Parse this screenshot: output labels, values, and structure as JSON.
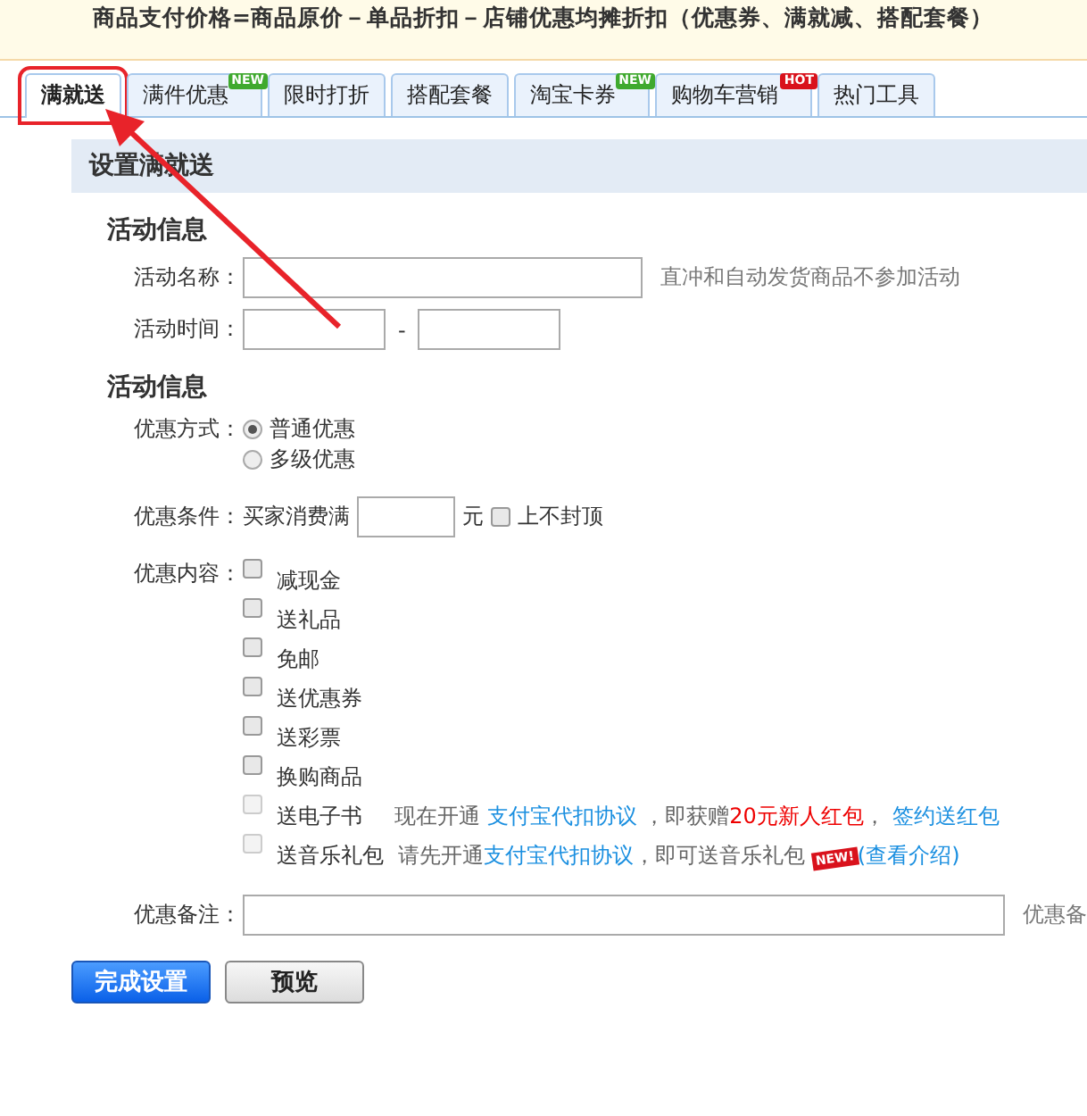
{
  "banner": {
    "text": "商品支付价格=商品原价－单品折扣－店铺优惠均摊折扣（优惠券、满就减、搭配套餐）"
  },
  "tabs": [
    {
      "label": "满就送",
      "selected": true
    },
    {
      "label": "满件优惠",
      "selected": false,
      "badge": {
        "kind": "new",
        "text": "NEW"
      }
    },
    {
      "label": "限时打折",
      "selected": false
    },
    {
      "label": "搭配套餐",
      "selected": false
    },
    {
      "label": "淘宝卡券",
      "selected": false,
      "badge": {
        "kind": "new",
        "text": "NEW"
      }
    },
    {
      "label": "购物车营销",
      "selected": false,
      "badge": {
        "kind": "hot",
        "text": "HOT"
      }
    },
    {
      "label": "热门工具",
      "selected": false
    }
  ],
  "panel": {
    "title": "设置满就送",
    "info": {
      "heading": "活动信息",
      "name_label": "活动名称：",
      "name_hint": "直冲和自动发货商品不参加活动",
      "time_label": "活动时间：",
      "time_separator": "-"
    },
    "offer": {
      "heading": "活动信息",
      "mode_label": "优惠方式：",
      "modes": [
        {
          "label": "普通优惠",
          "selected": true
        },
        {
          "label": "多级优惠",
          "selected": false
        }
      ],
      "condition_label": "优惠条件：",
      "condition_prefix": "买家消费满",
      "condition_unit": "元",
      "no_cap": {
        "label": "上不封顶",
        "checked": false
      },
      "content_label": "优惠内容：",
      "contents": [
        {
          "label": "减现金",
          "checked": false,
          "disabled": false
        },
        {
          "label": "送礼品",
          "checked": false,
          "disabled": false
        },
        {
          "label": "免邮",
          "checked": false,
          "disabled": false
        },
        {
          "label": "送优惠券",
          "checked": false,
          "disabled": false
        },
        {
          "label": "送彩票",
          "checked": false,
          "disabled": false
        },
        {
          "label": "换购商品",
          "checked": false,
          "disabled": false
        },
        {
          "label": "送电子书",
          "checked": false,
          "disabled": true,
          "note": [
            {
              "kind": "text",
              "text": "现在开通 "
            },
            {
              "kind": "link",
              "text": "支付宝代扣协议"
            },
            {
              "kind": "text",
              "text": " ，即获赠"
            },
            {
              "kind": "highlight",
              "text": "20元新人红包"
            },
            {
              "kind": "text",
              "text": "，  "
            },
            {
              "kind": "link",
              "text": "签约送红包"
            }
          ]
        },
        {
          "label": "送音乐礼包",
          "checked": false,
          "disabled": true,
          "note": [
            {
              "kind": "text",
              "text": "请先开通"
            },
            {
              "kind": "link",
              "text": "支付宝代扣协议"
            },
            {
              "kind": "text",
              "text": "，即可送音乐礼包 "
            },
            {
              "kind": "badge",
              "text": "NEW!"
            },
            {
              "kind": "link",
              "text": "(查看介绍)"
            }
          ]
        }
      ],
      "remark_label": "优惠备注：",
      "remark_hint": "优惠备"
    }
  },
  "buttons": [
    {
      "label": "完成设置",
      "kind": "primary"
    },
    {
      "label": "预览",
      "kind": "secondary"
    }
  ]
}
